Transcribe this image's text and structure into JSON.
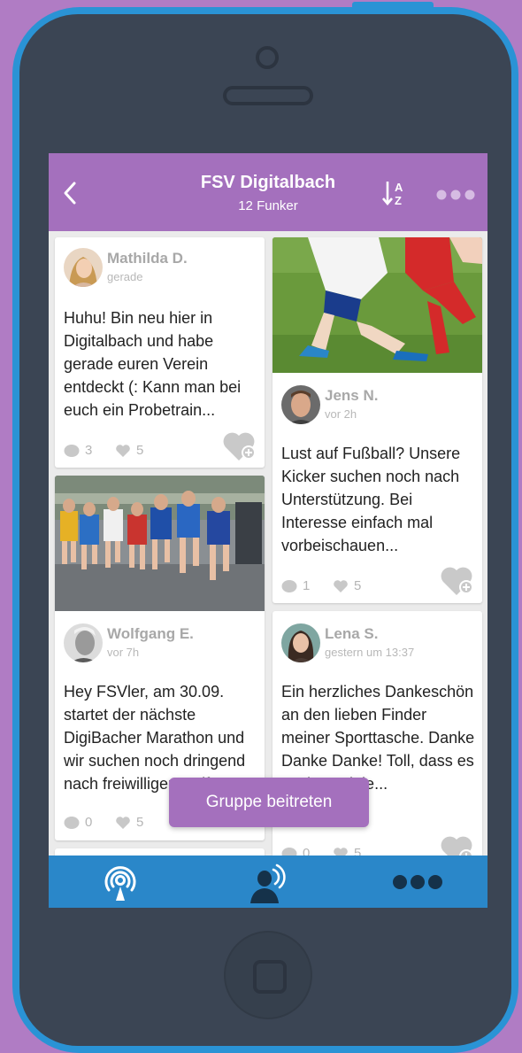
{
  "header": {
    "title": "FSV Digitalbach",
    "subtitle": "12 Funker",
    "back_icon": "chevron-left-icon",
    "sort_icon": "sort-alpha-icon",
    "more_icon": "more-dots-icon"
  },
  "posts": [
    {
      "author": "Mathilda D.",
      "time": "gerade",
      "text": "Huhu! Bin neu hier in Digitalbach und habe gerade euren Verein entdeckt (: Kann man bei euch ein Probetrain...",
      "comments": "3",
      "likes": "5"
    },
    {
      "author": "Jens N.",
      "time": "vor 2h",
      "text": "Lust auf Fußball? Unsere Kicker suchen noch nach Unterstützung. Bei Interesse einfach mal vorbeischauen...",
      "comments": "1",
      "likes": "5"
    },
    {
      "author": "Wolfgang E.",
      "time": "vor 7h",
      "text": "Hey FSVler, am 30.09. startet der nächste DigiBacher Marathon und wir suchen noch dringend nach freiwilligen Helf...",
      "comments": "0",
      "likes": "5"
    },
    {
      "author": "Lena S.",
      "time": "gestern um 13:37",
      "text": "Ein herzliches Dankeschön an den lieben Finder meiner Sporttasche. Danke Danke Danke! Toll, dass es noch so viele...",
      "comments": "0",
      "likes": "5"
    }
  ],
  "join_button": "Gruppe beitreten",
  "bottom_nav": {
    "items": [
      "broadcast-icon",
      "user-voice-icon",
      "more-dots-icon"
    ]
  },
  "colors": {
    "accent": "#a470bd",
    "phone_frame": "#2a93d5",
    "nav_bar": "#2a87c9",
    "background": "#b07cc4"
  }
}
